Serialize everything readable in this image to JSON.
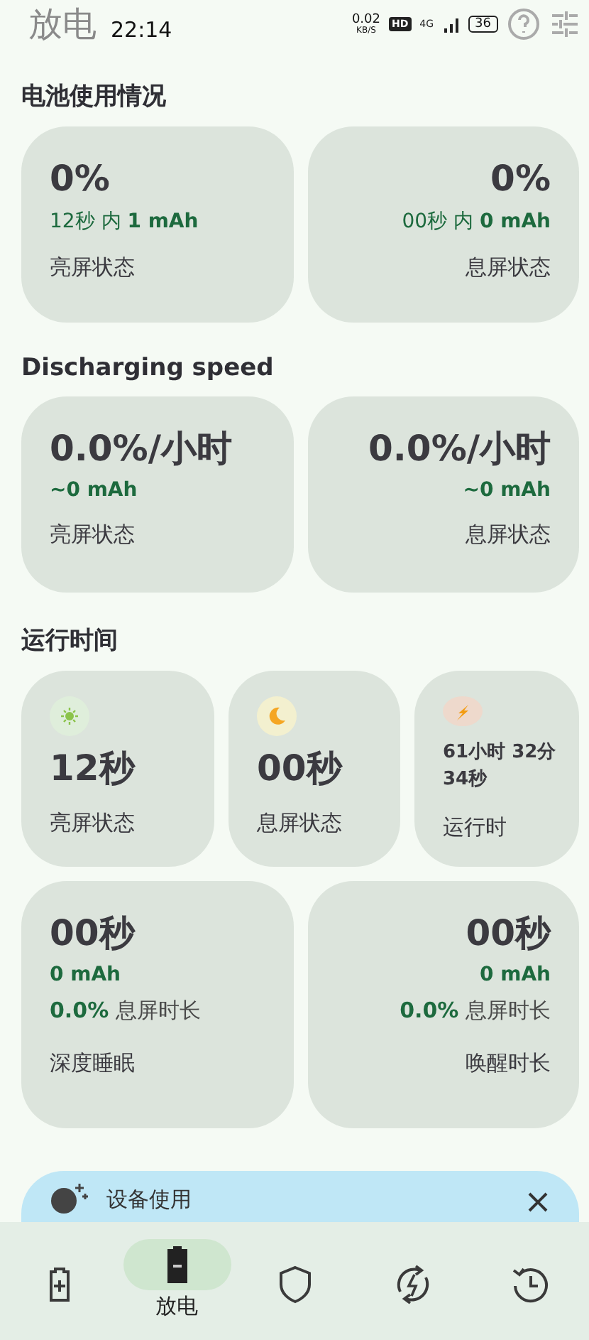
{
  "app_bar": {
    "title": "放电"
  },
  "status_bar": {
    "time": "22:14",
    "net_speed": "0.02",
    "net_unit": "KB/S",
    "hd": "HD",
    "network": "4G",
    "battery": "36"
  },
  "sections": [
    {
      "title": "电池使用情况",
      "kind": "pair",
      "cards": [
        {
          "value": "0%",
          "detail": "12秒 内 **1 mAh**",
          "label": "亮屏状态"
        },
        {
          "value": "0%",
          "detail": "00秒 内 **0 mAh**",
          "label": "息屏状态"
        }
      ]
    },
    {
      "title": "Discharging speed",
      "kind": "pair",
      "cards": [
        {
          "value": "0.0%/小时",
          "detail": "**~0 mAh**",
          "label": "亮屏状态"
        },
        {
          "value": "0.0%/小时",
          "detail": "**~0 mAh**",
          "label": "息屏状态"
        }
      ]
    },
    {
      "title": "运行时间",
      "kind": "triple",
      "cards": [
        {
          "value": "12秒",
          "label": "亮屏状态"
        },
        {
          "value": "00秒",
          "label": "息屏状态"
        },
        {
          "value": "61小时 32分 34秒",
          "label": "运行时"
        }
      ]
    },
    {
      "kind": "sleep",
      "cards": [
        {
          "value": "00秒",
          "mah": "0 mAh",
          "percent": "0.0%",
          "percent_label": "息屏时长",
          "label": "深度睡眠"
        },
        {
          "value": "00秒",
          "mah": "0 mAh",
          "percent": "0.0%",
          "percent_label": "息屏时长",
          "label": "唤醒时长"
        }
      ]
    }
  ],
  "banner": {
    "title": "设备使用"
  },
  "nav": [
    {
      "selected": false
    },
    {
      "label": "放电",
      "selected": true
    },
    {
      "selected": false
    },
    {
      "selected": false
    },
    {
      "selected": false
    }
  ]
}
